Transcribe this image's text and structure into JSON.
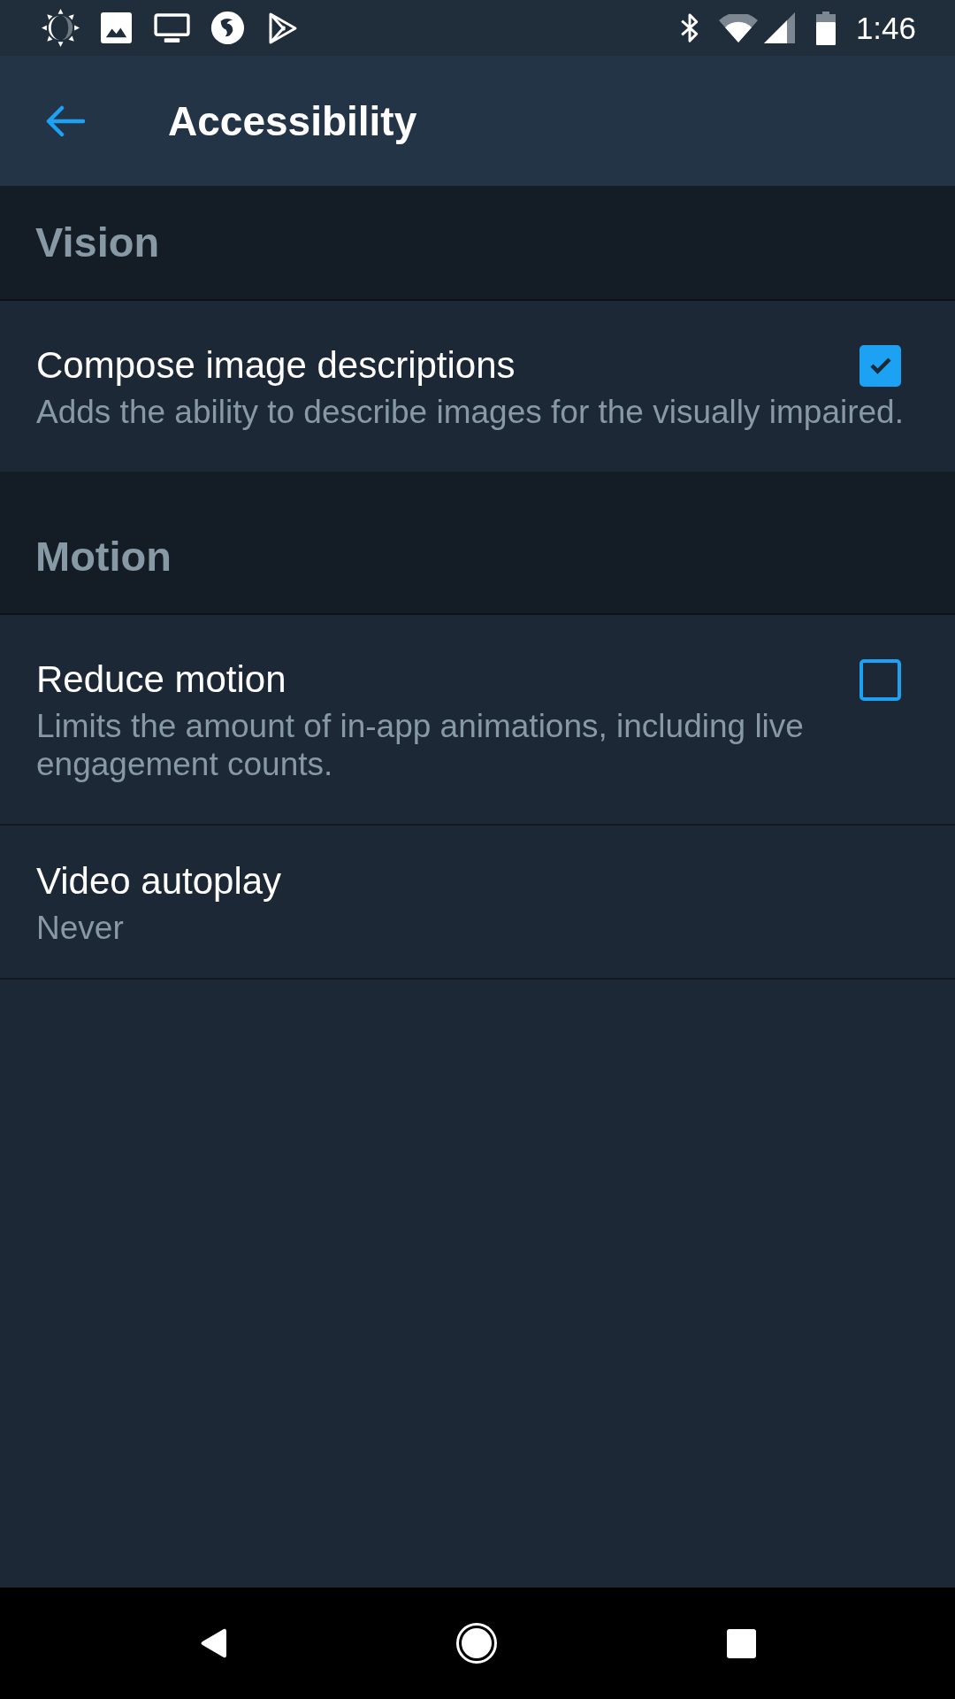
{
  "status_bar": {
    "time": "1:46"
  },
  "app_bar": {
    "title": "Accessibility"
  },
  "sections": [
    {
      "title": "Vision",
      "items": [
        {
          "kind": "checkbox",
          "title": "Compose image descriptions",
          "subtitle": "Adds the ability to describe images for the visually impaired.",
          "checked": true
        }
      ]
    },
    {
      "title": "Motion",
      "items": [
        {
          "kind": "checkbox",
          "title": "Reduce motion",
          "subtitle": "Limits the amount of in-app animations, including live engagement counts.",
          "checked": false
        },
        {
          "kind": "value",
          "title": "Video autoplay",
          "value": "Never"
        }
      ]
    }
  ]
}
